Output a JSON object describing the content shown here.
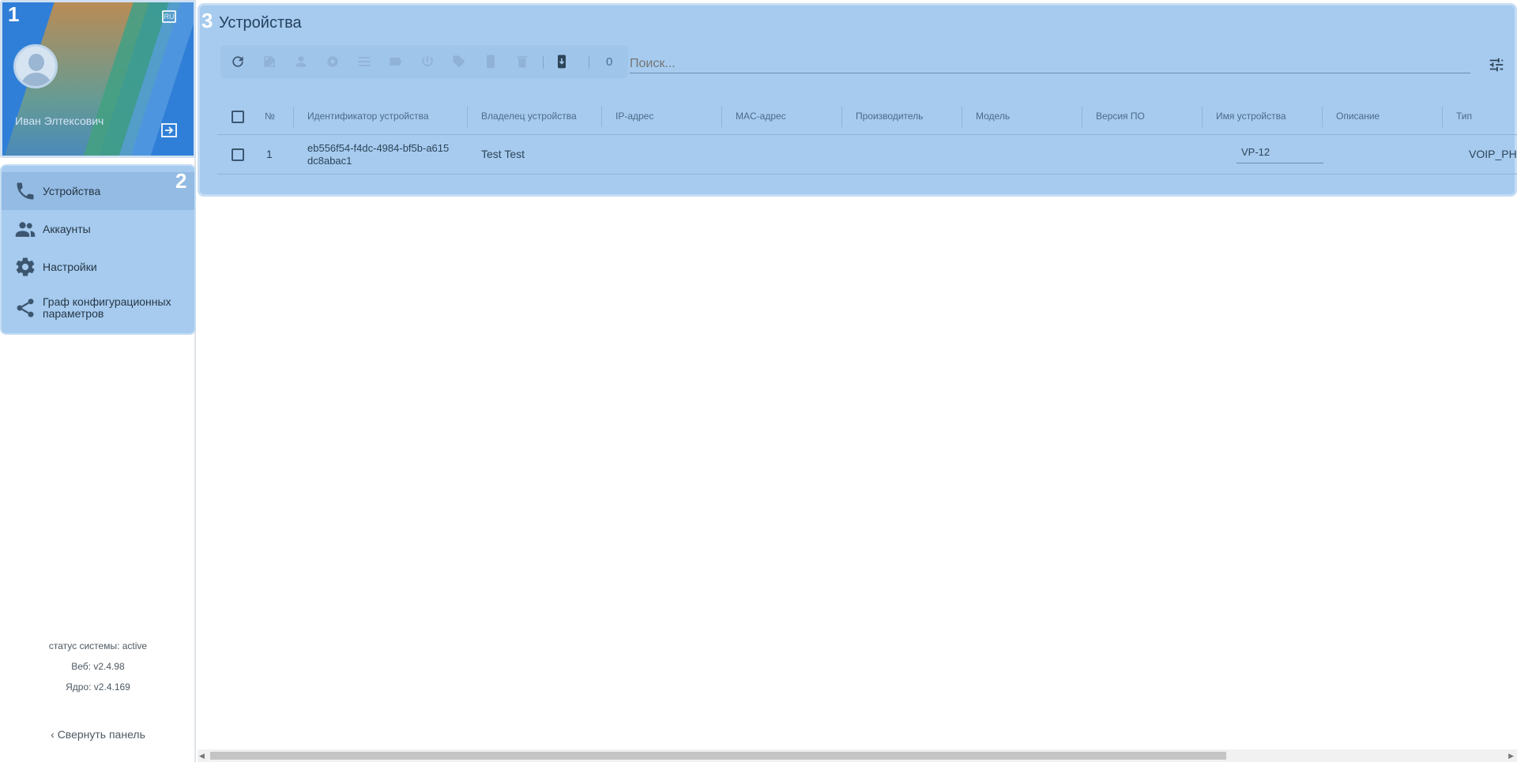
{
  "profile": {
    "user_name": "Иван Элтексович",
    "lang_badge": "RU",
    "badge": "1"
  },
  "nav": {
    "badge": "2",
    "items": [
      {
        "label": "Устройства",
        "icon": "phone-icon",
        "active": true
      },
      {
        "label": "Аккаунты",
        "icon": "people-icon"
      },
      {
        "label": "Настройки",
        "icon": "gear-icon"
      },
      {
        "label": "Граф конфигурационных параметров",
        "icon": "share-icon"
      }
    ]
  },
  "system": {
    "status": "статус системы:  active",
    "web": "Веб: v2.4.98",
    "core": "Ядро: v2.4.169"
  },
  "collapse_label": "Свернуть панель",
  "main": {
    "badge": "3",
    "title": "Устройства",
    "selected_count": "0",
    "search_placeholder": "Поиск...",
    "columns": [
      "№",
      "Идентификатор устройства",
      "Владелец устройства",
      "IP-адрес",
      "MAC-адрес",
      "Производитель",
      "Модель",
      "Версия ПО",
      "Имя устройства",
      "Описание",
      "Тип"
    ],
    "rows": [
      {
        "num": "1",
        "device_id": "eb556f54-f4dc-4984-bf5b-a615dc8abac1",
        "owner": "Test Test",
        "ip": "",
        "mac": "",
        "vendor": "",
        "model": "",
        "firmware": "",
        "device_name": "VP-12",
        "description": "",
        "type": "VOIP_PHONE"
      }
    ]
  },
  "colors": {
    "accent_panel": "#a6cbef",
    "active_item": "#93bbe3",
    "profile_bg": "#2f7fd8"
  }
}
